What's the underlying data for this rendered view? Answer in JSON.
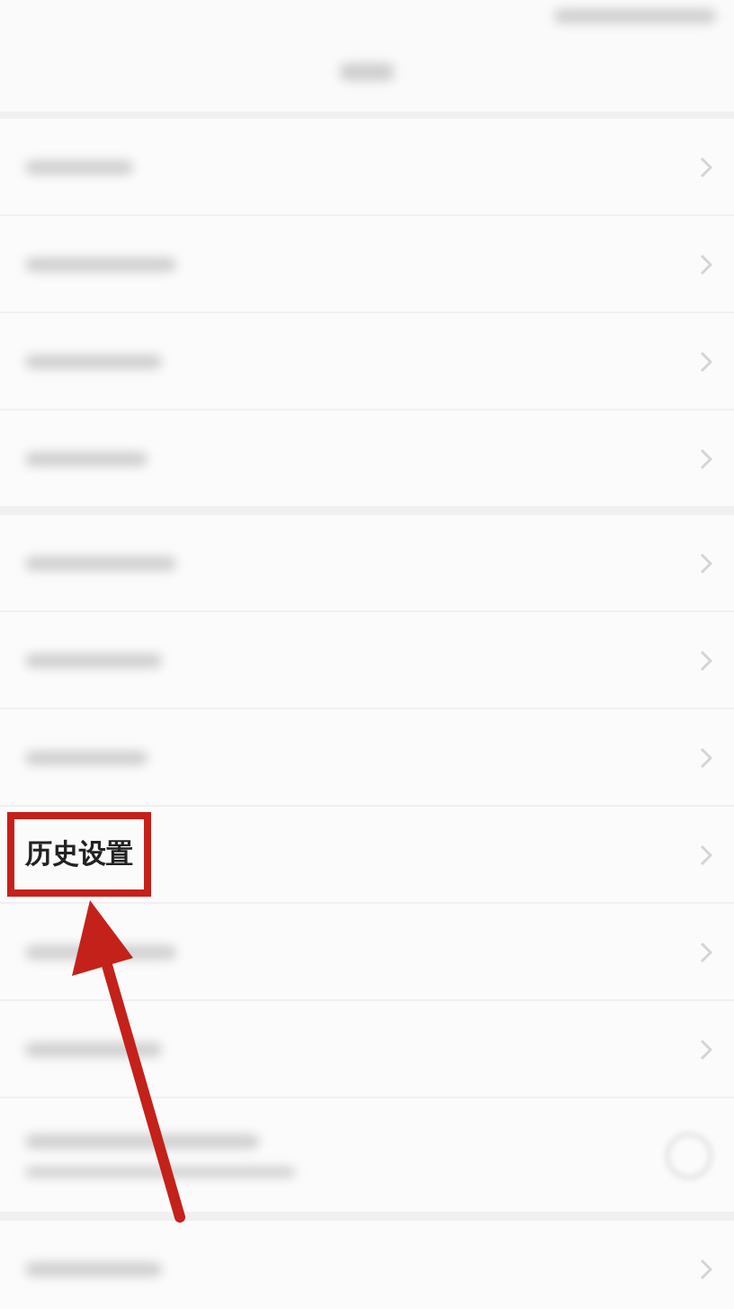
{
  "sections": [
    {
      "rows": [
        {
          "kind": "blurred",
          "highlighted": false
        },
        {
          "kind": "blurred",
          "highlighted": false
        },
        {
          "kind": "blurred",
          "highlighted": false
        },
        {
          "kind": "blurred",
          "highlighted": false
        }
      ]
    },
    {
      "rows": [
        {
          "kind": "blurred",
          "highlighted": false
        },
        {
          "kind": "blurred",
          "highlighted": false
        },
        {
          "kind": "blurred",
          "highlighted": false
        },
        {
          "kind": "text",
          "label": "历史设置",
          "highlighted": true
        },
        {
          "kind": "blurred",
          "highlighted": false
        },
        {
          "kind": "blurred",
          "highlighted": false
        },
        {
          "kind": "toggle",
          "on": false,
          "highlighted": false
        }
      ]
    },
    {
      "rows": [
        {
          "kind": "blurred",
          "highlighted": false
        }
      ]
    }
  ]
}
